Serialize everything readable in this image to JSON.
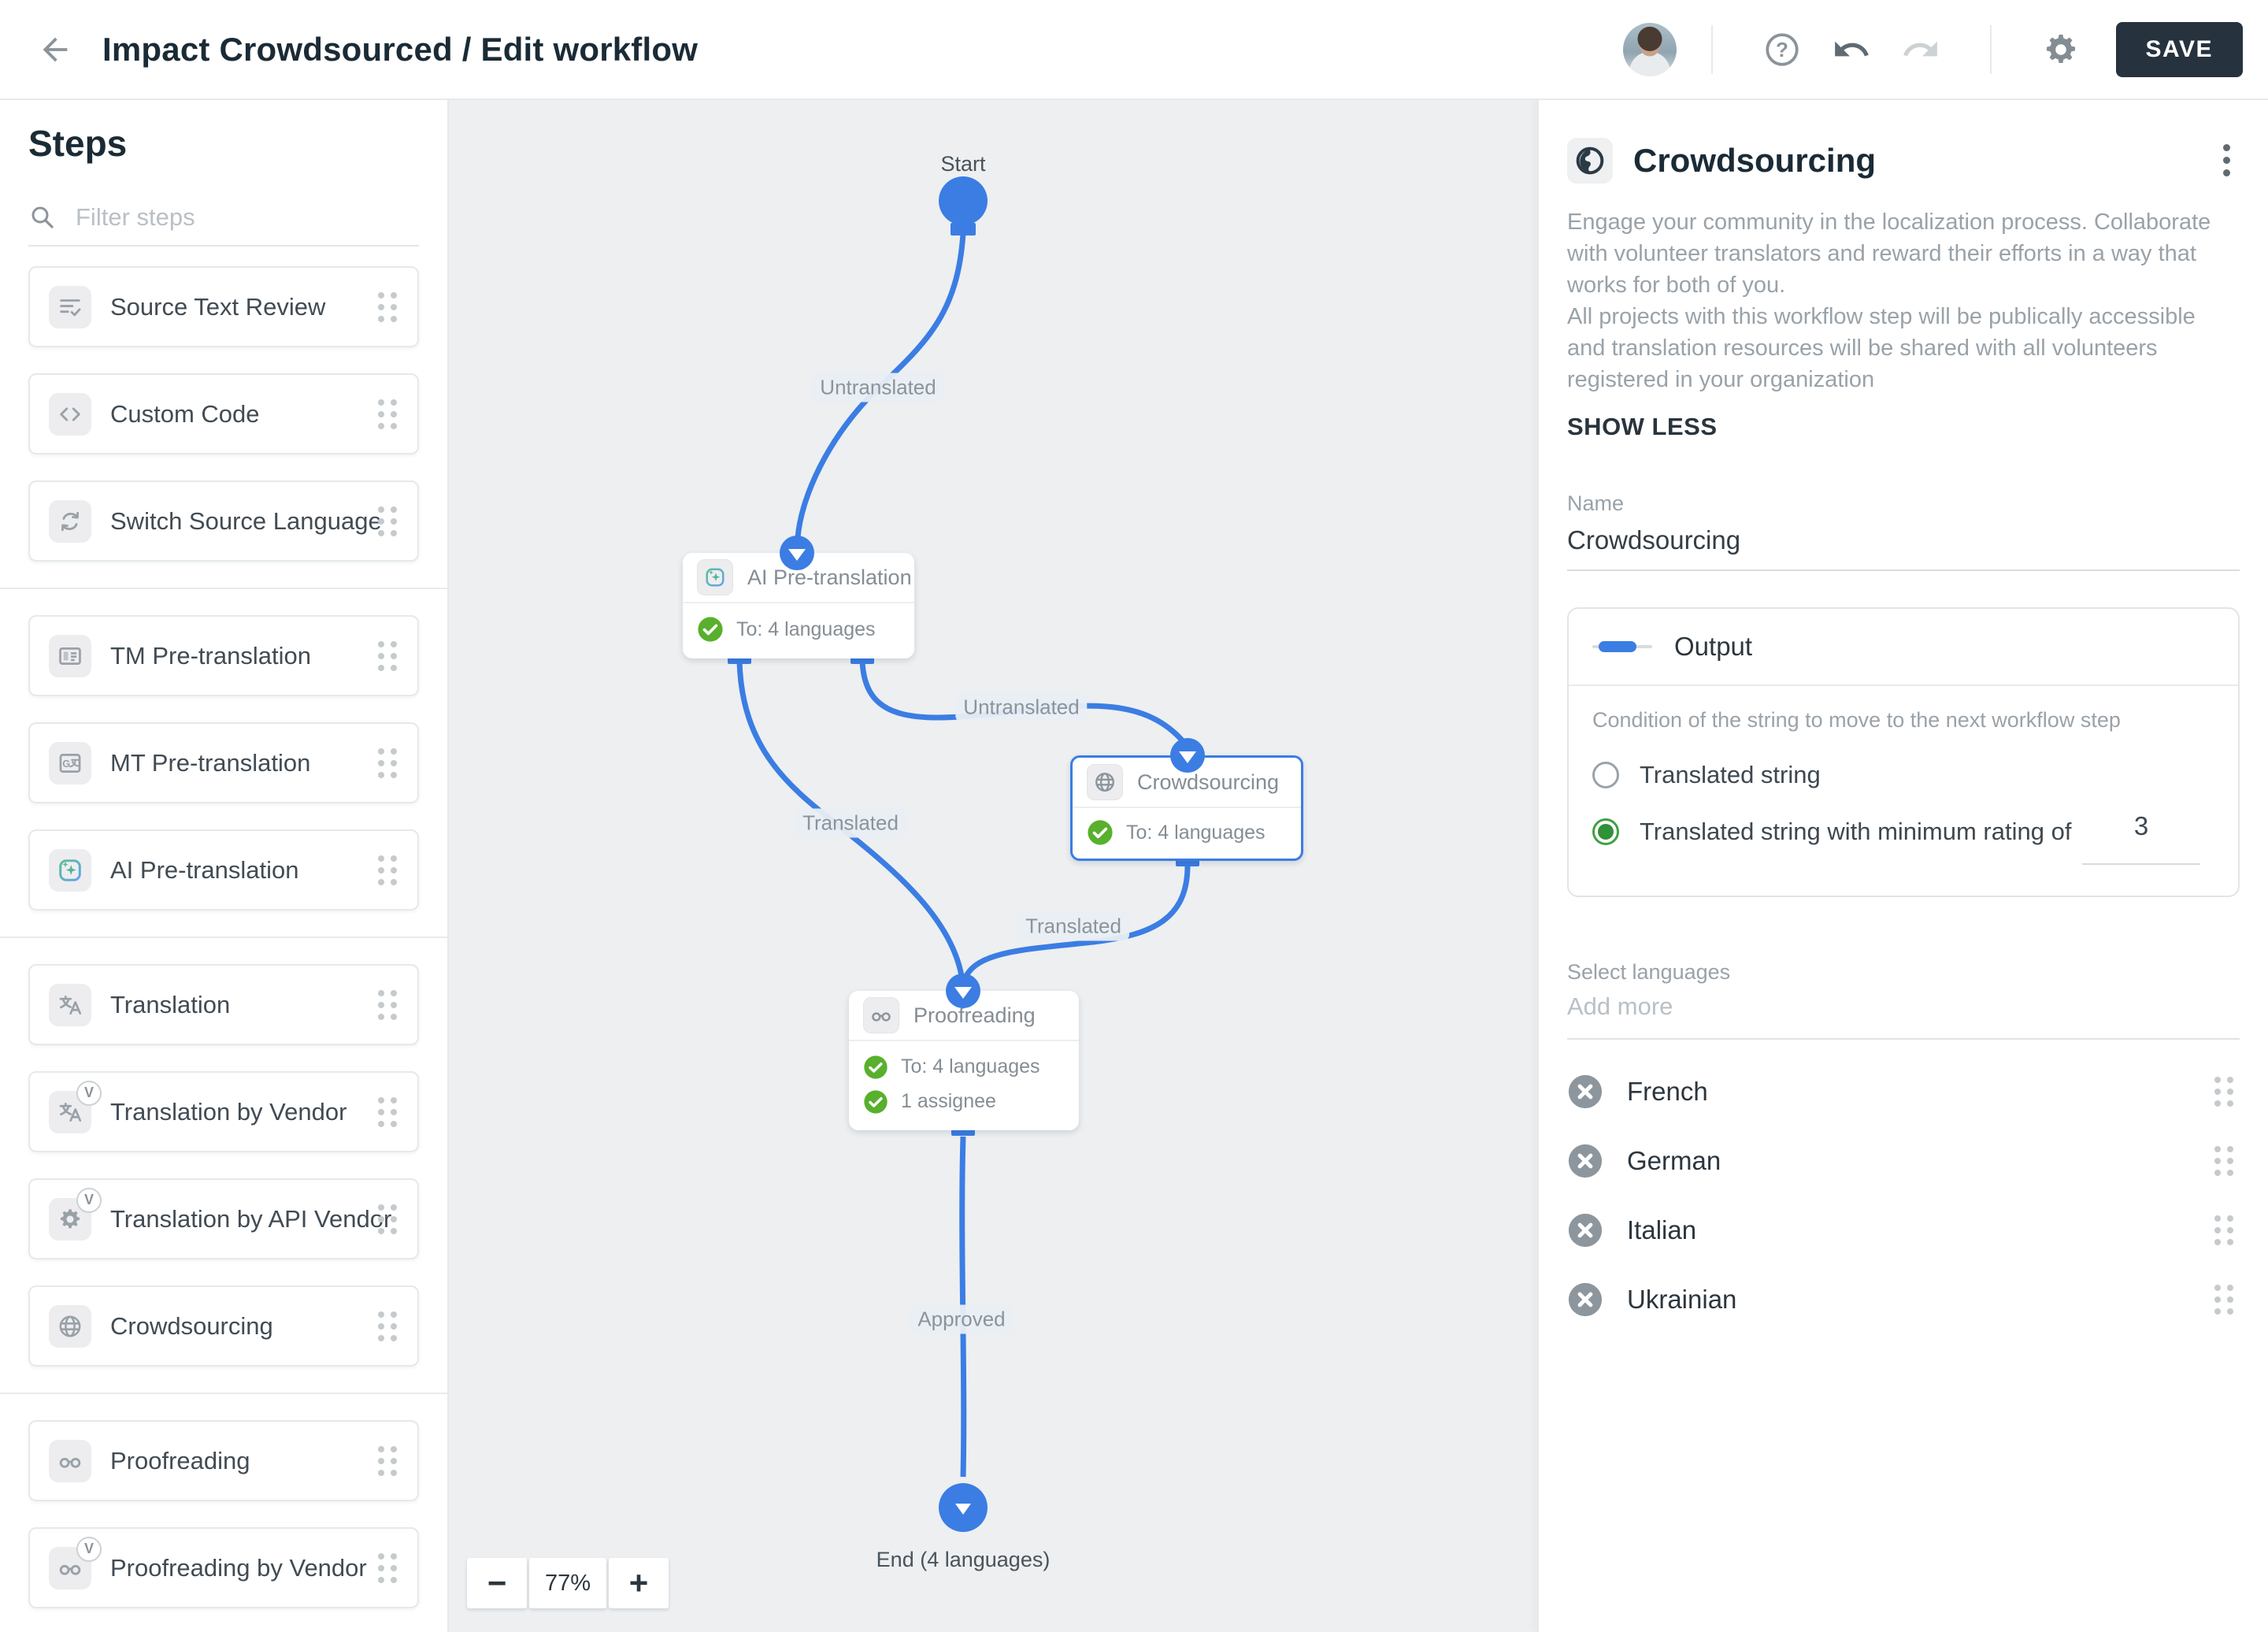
{
  "colors": {
    "accent_blue": "#3b7de3",
    "check_green": "#58b02c",
    "radio_green": "#3fa044",
    "save_dark": "#26323e",
    "canvas_bg": "#edeff1"
  },
  "icons": {
    "back": "arrow-left-icon",
    "help": "question-circle-icon",
    "undo": "undo-arrow-icon",
    "redo": "redo-arrow-icon",
    "settings": "gear-icon",
    "menu": "kebab-icon",
    "search": "magnifier-icon",
    "drag": "six-dots-handle-icon",
    "remove": "x-circle-icon",
    "done": "check-circle-icon"
  },
  "header": {
    "title": "Impact Crowdsourced / Edit workflow",
    "save": "SAVE"
  },
  "sidebar": {
    "title": "Steps",
    "filter_placeholder": "Filter steps",
    "vendor_badge": "V",
    "items": [
      {
        "label": "Source Text Review"
      },
      {
        "label": "Custom Code"
      },
      {
        "label": "Switch Source Language"
      },
      {
        "label": "TM Pre-translation"
      },
      {
        "label": "MT Pre-translation"
      },
      {
        "label": "AI Pre-translation"
      },
      {
        "label": "Translation"
      },
      {
        "label": "Translation by Vendor"
      },
      {
        "label": "Translation by API Vendor"
      },
      {
        "label": "Crowdsourcing"
      },
      {
        "label": "Proofreading"
      },
      {
        "label": "Proofreading by Vendor"
      }
    ]
  },
  "canvas": {
    "start_label": "Start",
    "end_label": "End (4 languages)",
    "labels": {
      "untranslated_top": "Untranslated",
      "untranslated_mid": "Untranslated",
      "translated_left": "Translated",
      "translated_right": "Translated",
      "approved": "Approved"
    },
    "nodes": {
      "ai": {
        "title": "AI Pre-translation",
        "to": "To: 4 languages"
      },
      "crowdsourcing": {
        "title": "Crowdsourcing",
        "to": "To: 4 languages"
      },
      "proofreading": {
        "title": "Proofreading",
        "to": "To: 4 languages",
        "assignee": "1 assignee"
      }
    },
    "zoom": {
      "minus": "−",
      "value": "77%",
      "plus": "+"
    }
  },
  "panel": {
    "title": "Crowdsourcing",
    "description_1": "Engage your community in the localization process. Collaborate with volunteer translators and reward their efforts in a way that works for both of you.",
    "description_2": "All projects with this workflow step will be publically accessible and translation resources will be shared with all volunteers registered in your organization",
    "show_less": "SHOW LESS",
    "name_label": "Name",
    "name_value": "Crowdsourcing",
    "output": {
      "title": "Output",
      "condition": "Condition of the string to move to the next workflow step",
      "option_1": "Translated string",
      "option_2": "Translated string with minimum rating of",
      "option_2_value": "3"
    },
    "select_languages": "Select languages",
    "add_more_placeholder": "Add more",
    "languages": [
      {
        "name": "French"
      },
      {
        "name": "German"
      },
      {
        "name": "Italian"
      },
      {
        "name": "Ukrainian"
      }
    ]
  }
}
